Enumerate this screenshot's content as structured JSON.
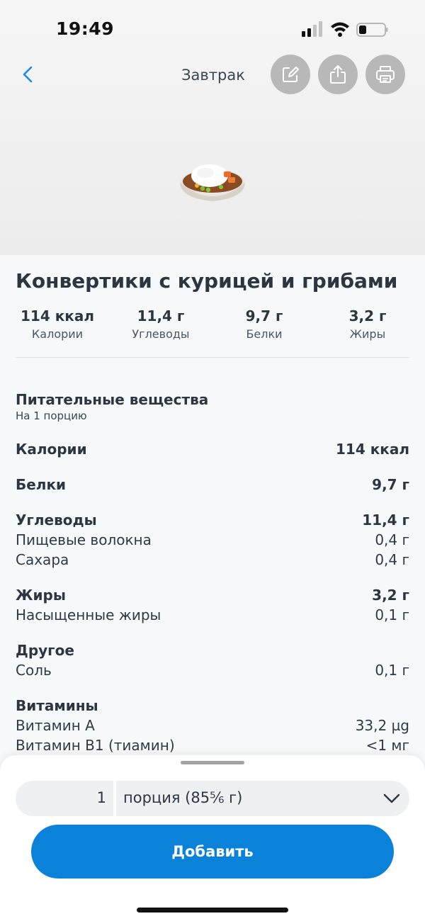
{
  "status_bar": {
    "time": "19:49"
  },
  "nav": {
    "title": "Завтрак"
  },
  "food": {
    "icon": "rice-curry-bowl-icon",
    "name": "Конвертики с курицей и грибами",
    "macros": [
      {
        "value": "114 ккал",
        "label": "Калории"
      },
      {
        "value": "11,4 г",
        "label": "Углеводы"
      },
      {
        "value": "9,7 г",
        "label": "Белки"
      },
      {
        "value": "3,2 г",
        "label": "Жиры"
      }
    ]
  },
  "nutrients": {
    "title": "Питательные вещества",
    "subtitle": "На 1 порцию",
    "rows": [
      {
        "label": "Калории",
        "value": "114 ккал"
      },
      {
        "label": "Белки",
        "value": "9,7 г"
      },
      {
        "label": "Углеводы",
        "value": "11,4 г"
      },
      {
        "label": "Пищевые волокна",
        "value": "0,4 г"
      },
      {
        "label": "Сахара",
        "value": "0,4 г"
      },
      {
        "label": "Жиры",
        "value": "3,2 г"
      },
      {
        "label": "Насыщенные жиры",
        "value": "0,1 г"
      },
      {
        "label": "Другое",
        "value": ""
      },
      {
        "label": "Соль",
        "value": "0,1 г"
      },
      {
        "label": "Витамины",
        "value": ""
      },
      {
        "label": "Витамин A",
        "value": "33,2 µg"
      },
      {
        "label": "Витамин B1 (тиамин)",
        "value": "<1 мг"
      }
    ]
  },
  "portion": {
    "quantity": "1",
    "unit": "порция (85⅚ г)",
    "add_label": "Добавить"
  },
  "colors": {
    "accent": "#0b82d9",
    "back_arrow": "#1a8ae5",
    "action_circle": "#b8b8b8"
  }
}
